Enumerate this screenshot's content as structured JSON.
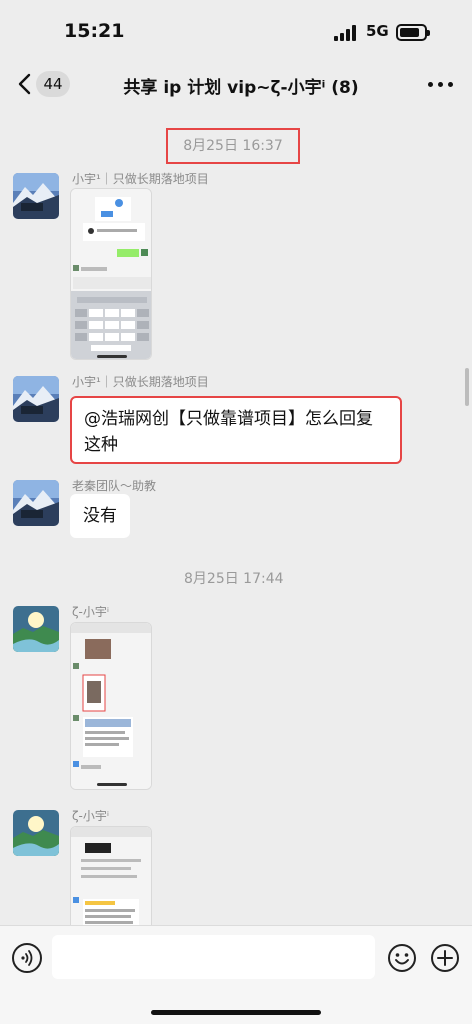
{
  "status_bar": {
    "time": "15:21",
    "network": "5G"
  },
  "nav": {
    "unread_count": "44",
    "title": "共享 ip 计划 vip~ζ-小宇ⁱ  (8)"
  },
  "chat": {
    "timestamps": [
      "8月25日 16:37",
      "8月25日 17:44"
    ],
    "messages": [
      {
        "sender": "小宇¹｜只做长期落地项目",
        "type": "image"
      },
      {
        "sender": "小宇¹｜只做长期落地项目",
        "type": "text",
        "text": "@浩瑞网创【只做靠谱项目】怎么回复这种"
      },
      {
        "sender": "老秦团队～助教",
        "type": "text",
        "text": "没有"
      },
      {
        "sender": "ζ-小宇ⁱ",
        "type": "image"
      },
      {
        "sender": "ζ-小宇ⁱ",
        "type": "image"
      }
    ]
  },
  "icons": {
    "back": "back-arrow-icon",
    "more": "more-dots-icon",
    "voice": "voice-icon",
    "emoji": "emoji-icon",
    "plus": "plus-icon",
    "signal": "signal-icon",
    "battery": "battery-icon"
  },
  "colors": {
    "background": "#ededed",
    "highlight_box": "#e64545",
    "bubble": "#ffffff",
    "accent_green": "#95ec69"
  }
}
